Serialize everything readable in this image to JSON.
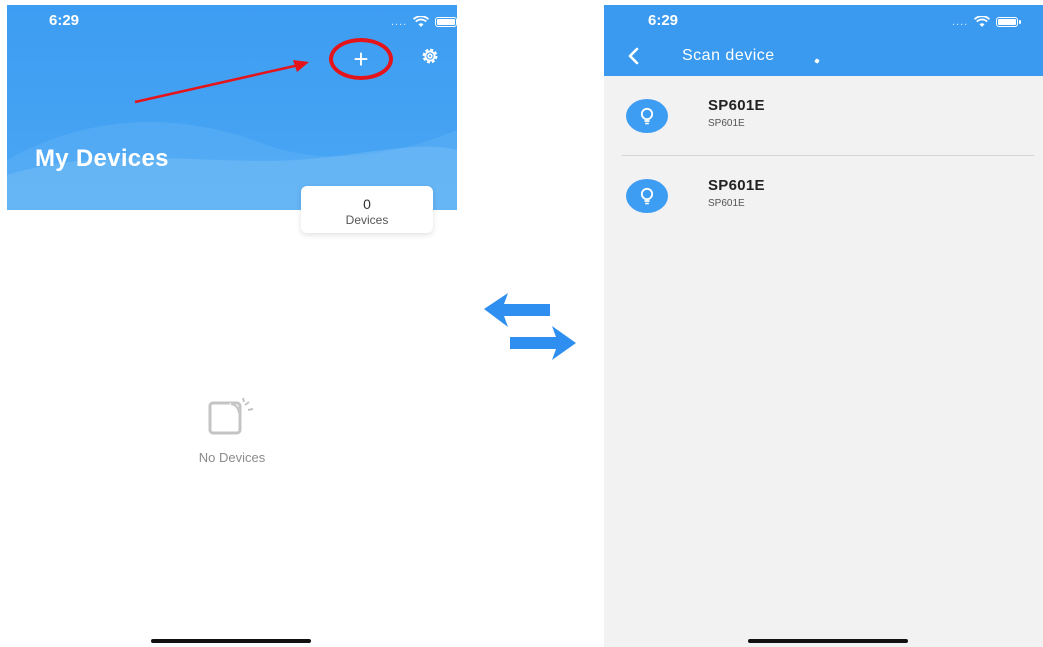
{
  "left_screen": {
    "status_time": "6:29",
    "add_label": "+",
    "title": "My Devices",
    "device_count": "0",
    "device_count_label": "Devices",
    "empty_text": "No Devices",
    "colors": {
      "header": "#3d9df2",
      "highlight_circle": "#e5141b",
      "annotation_arrow": "#e5141b"
    },
    "icons": [
      "plus-icon",
      "gear-icon",
      "empty-device-icon"
    ]
  },
  "right_screen": {
    "status_time": "6:29",
    "title": "Scan device",
    "devices": [
      {
        "name": "SP601E",
        "subtitle": "SP601E"
      },
      {
        "name": "SP601E",
        "subtitle": "SP601E"
      }
    ],
    "colors": {
      "nav": "#3a9af0",
      "device_icon_bg": "#3d9df2"
    },
    "icons": [
      "back-chevron-icon",
      "lightbulb-icon"
    ]
  },
  "center": {
    "icon": "swap-arrows-icon",
    "color": "#2f8ff0"
  }
}
